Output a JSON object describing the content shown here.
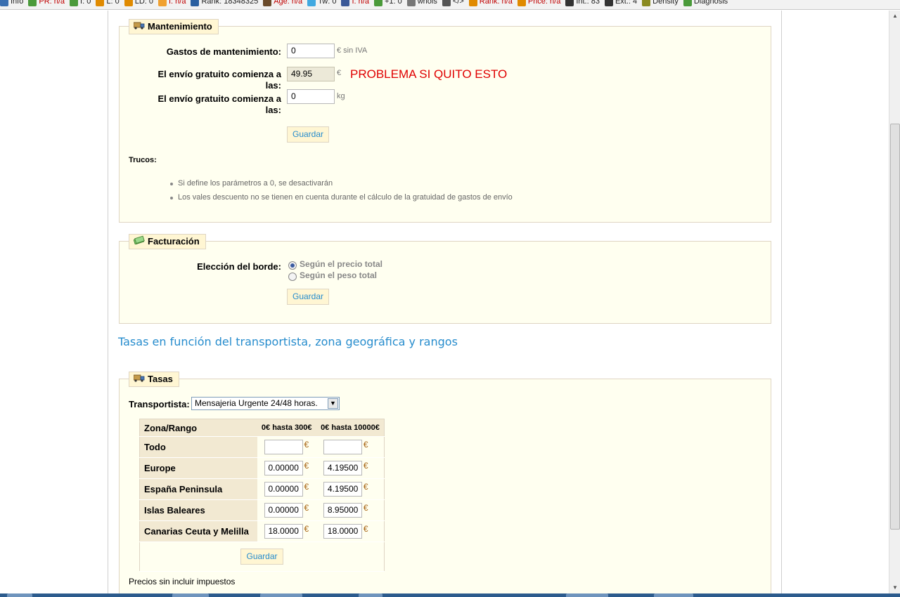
{
  "seo_toolbar": {
    "items": [
      {
        "text": "Info",
        "icon": "info-icon",
        "color": "#3a6fb0",
        "alert": false
      },
      {
        "text": "PR: n/a",
        "icon": "google-pr-icon",
        "color": "#4a9a3a",
        "alert": true
      },
      {
        "text": "I: 0",
        "icon": "google-index-icon",
        "color": "#4a9a3a",
        "alert": false
      },
      {
        "text": "L: 0",
        "icon": "links-icon",
        "color": "#e08a00",
        "alert": false
      },
      {
        "text": "LD: 0",
        "icon": "link-domains-icon",
        "color": "#e08a00",
        "alert": false
      },
      {
        "text": "I: n/a",
        "icon": "bing-index-icon",
        "color": "#f0a030",
        "alert": true
      },
      {
        "text": "Rank: 18348325",
        "icon": "alexa-rank-icon",
        "color": "#2a5fa0",
        "alert": false
      },
      {
        "text": "Age: n/a",
        "icon": "archive-age-icon",
        "color": "#6a4a2a",
        "alert": true
      },
      {
        "text": "Tw: 0",
        "icon": "twitter-icon",
        "color": "#40a8e0",
        "alert": false
      },
      {
        "text": "I: n/a",
        "icon": "facebook-icon",
        "color": "#3b5998",
        "alert": true
      },
      {
        "text": "+1: 0",
        "icon": "google-plus-icon",
        "color": "#4a9a3a",
        "alert": false
      },
      {
        "text": "whois",
        "icon": "whois-icon",
        "color": "#777777",
        "alert": false
      },
      {
        "text": "</>",
        "icon": "source-code-icon",
        "color": "#555555",
        "alert": false
      },
      {
        "text": "Rank: n/a",
        "icon": "semrush-rank-icon",
        "color": "#e08a00",
        "alert": true
      },
      {
        "text": "Price: n/a",
        "icon": "price-icon",
        "color": "#e08a00",
        "alert": true
      },
      {
        "text": "Int.: 83",
        "icon": "internal-links-icon",
        "color": "#333333",
        "alert": false
      },
      {
        "text": "Ext.: 4",
        "icon": "external-links-icon",
        "color": "#333333",
        "alert": false
      },
      {
        "text": "Density",
        "icon": "density-icon",
        "color": "#8a8a20",
        "alert": false
      },
      {
        "text": "Diagnosis",
        "icon": "diagnosis-icon",
        "color": "#4a9a3a",
        "alert": false
      }
    ]
  },
  "mantenimiento": {
    "legend": "Mantenimiento",
    "legend_icon": "delivery-truck-icon",
    "handling_label": "Gastos de mantenimiento:",
    "handling_value": "0",
    "handling_unit": "€ sin IVA",
    "free_price_label": "El envío gratuito comienza a las:",
    "free_price_value": "49.95",
    "free_price_unit": "€",
    "annotation": "PROBLEMA SI QUITO ESTO",
    "free_weight_label": "El envío gratuito comienza a las:",
    "free_weight_value": "0",
    "free_weight_unit": "kg",
    "save_label": "Guardar",
    "tips_title": "Trucos:",
    "tips": [
      "Si define los parámetros a 0, se desactivarán",
      "Los vales descuento no se tienen en cuenta durante el cálculo de la gratuidad de gastos de envío"
    ]
  },
  "facturacion": {
    "legend": "Facturación",
    "legend_icon": "money-bills-icon",
    "billing_label": "Elección del borde:",
    "options": [
      "Según el precio total",
      "Según el peso total"
    ],
    "selected_index": 0,
    "save_label": "Guardar"
  },
  "tasas_section_title": "Tasas en función del transportista, zona geográfica y rangos",
  "tasas": {
    "legend": "Tasas",
    "legend_icon": "delivery-truck-icon",
    "carrier_label": "Transportista:",
    "carrier_selected": "Mensajeria Urgente 24/48 horas.",
    "table": {
      "header": [
        "Zona/Rango",
        "0€ hasta 300€",
        "0€ hasta 10000€"
      ],
      "currency_symbol": "€",
      "rows": [
        {
          "zone": "Todo",
          "values": [
            "",
            ""
          ]
        },
        {
          "zone": "Europe",
          "values": [
            "0.00000",
            "4.19500"
          ]
        },
        {
          "zone": "España Peninsula",
          "values": [
            "0.00000",
            "4.19500"
          ]
        },
        {
          "zone": "Islas Baleares",
          "values": [
            "0.00000",
            "8.95000"
          ]
        },
        {
          "zone": "Canarias Ceuta y Melilla",
          "values": [
            "18.0000",
            "18.0000"
          ]
        }
      ]
    },
    "save_label": "Guardar",
    "footnote": "Precios sin incluir impuestos"
  },
  "colors": {
    "accent_blue": "#268ccd",
    "panel_bg": "#fffff0",
    "legend_bg": "#fff6d3",
    "annotation_red": "#e00000",
    "euro_brown": "#a86514"
  }
}
